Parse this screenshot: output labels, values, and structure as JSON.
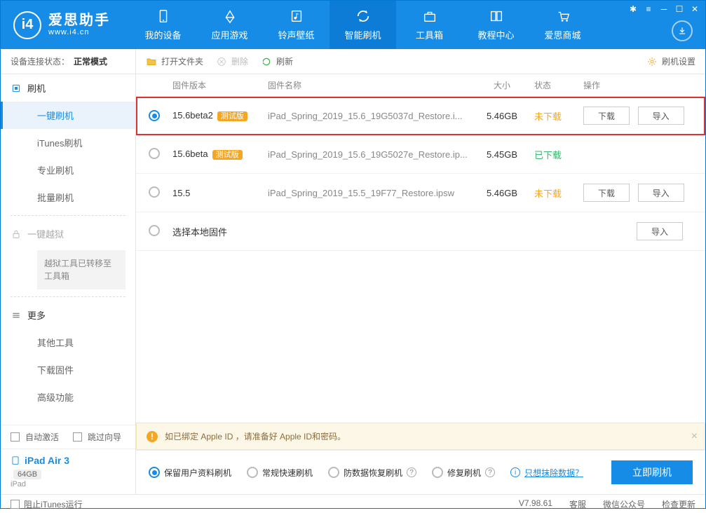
{
  "app": {
    "title": "爱思助手",
    "subtitle": "www.i4.cn"
  },
  "nav": [
    {
      "label": "我的设备"
    },
    {
      "label": "应用游戏"
    },
    {
      "label": "铃声壁纸"
    },
    {
      "label": "智能刷机"
    },
    {
      "label": "工具箱"
    },
    {
      "label": "教程中心"
    },
    {
      "label": "爱思商城"
    }
  ],
  "status": {
    "prefix": "设备连接状态：",
    "value": "正常模式"
  },
  "sidebar": {
    "group_flash": "刷机",
    "items": [
      "一键刷机",
      "iTunes刷机",
      "专业刷机",
      "批量刷机"
    ],
    "group_jailbreak": "一键越狱",
    "jailbreak_notice": "越狱工具已转移至工具箱",
    "group_more": "更多",
    "more_items": [
      "其他工具",
      "下载固件",
      "高级功能"
    ],
    "auto_activate": "自动激活",
    "skip_guide": "跳过向导",
    "device_name": "iPad Air 3",
    "device_storage": "64GB",
    "device_type": "iPad"
  },
  "toolbar": {
    "open_folder": "打开文件夹",
    "delete": "删除",
    "refresh": "刷新",
    "settings": "刷机设置"
  },
  "columns": {
    "version": "固件版本",
    "name": "固件名称",
    "size": "大小",
    "status": "状态",
    "ops": "操作"
  },
  "rows": [
    {
      "version": "15.6beta2",
      "beta": "测试版",
      "name": "iPad_Spring_2019_15.6_19G5037d_Restore.i...",
      "size": "5.46GB",
      "status": "未下载",
      "status_class": "nd",
      "checked": true,
      "download": "下载",
      "import": "导入"
    },
    {
      "version": "15.6beta",
      "beta": "测试版",
      "name": "iPad_Spring_2019_15.6_19G5027e_Restore.ip...",
      "size": "5.45GB",
      "status": "已下载",
      "status_class": "dl",
      "checked": false
    },
    {
      "version": "15.5",
      "beta": "",
      "name": "iPad_Spring_2019_15.5_19F77_Restore.ipsw",
      "size": "5.46GB",
      "status": "未下载",
      "status_class": "nd",
      "checked": false,
      "download": "下载",
      "import": "导入"
    }
  ],
  "local_row": {
    "label": "选择本地固件",
    "import": "导入"
  },
  "warning": "如已绑定 Apple ID ，请准备好 Apple ID和密码。",
  "options": {
    "opt1": "保留用户资料刷机",
    "opt2": "常规快速刷机",
    "opt3": "防数据恢复刷机",
    "opt4": "修复刷机",
    "erase_link": "只想抹除数据？",
    "flash_btn": "立即刷机"
  },
  "footer": {
    "block_itunes": "阻止iTunes运行",
    "version": "V7.98.61",
    "service": "客服",
    "wechat": "微信公众号",
    "update": "检查更新"
  }
}
